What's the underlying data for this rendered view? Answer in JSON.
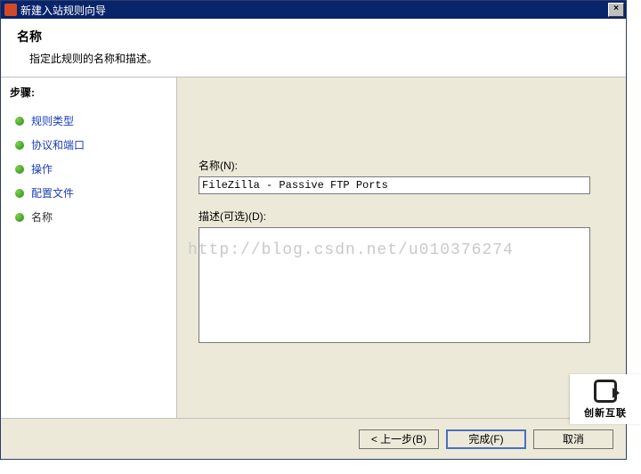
{
  "window": {
    "title": "新建入站规则向导",
    "close": "×"
  },
  "header": {
    "title": "名称",
    "subtitle": "指定此规则的名称和描述。"
  },
  "sidebar": {
    "title": "步骤:",
    "items": [
      {
        "label": "规则类型"
      },
      {
        "label": "协议和端口"
      },
      {
        "label": "操作"
      },
      {
        "label": "配置文件"
      },
      {
        "label": "名称"
      }
    ],
    "current_index": 4
  },
  "form": {
    "name_label": "名称(N):",
    "name_value": "FileZilla - Passive FTP Ports",
    "desc_label": "描述(可选)(D):",
    "desc_value": ""
  },
  "buttons": {
    "back": "< 上一步(B)",
    "finish": "完成(F)",
    "cancel": "取消"
  },
  "watermark": "http://blog.csdn.net/u010376274",
  "brand": "创新互联"
}
